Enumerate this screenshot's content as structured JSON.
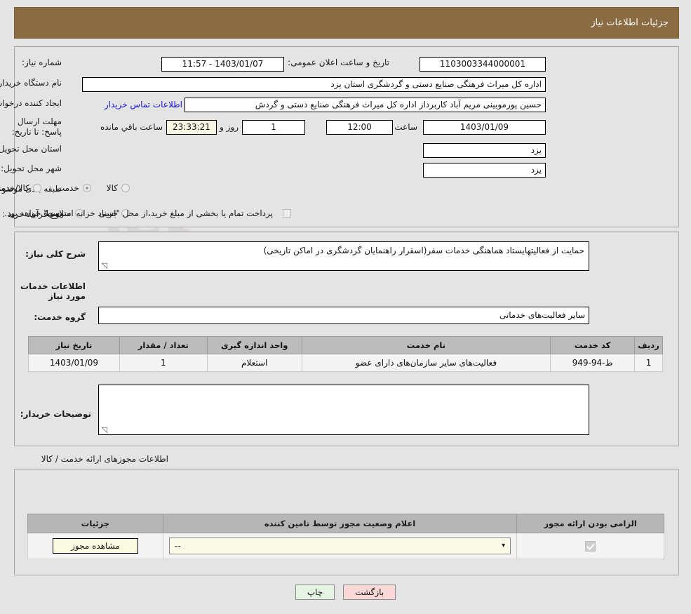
{
  "header": {
    "title": "جزئیات اطلاعات نیاز"
  },
  "fields": {
    "need_number_label": "شماره نیاز:",
    "need_number_value": "1103003344000001",
    "announce_label": "تاریخ و ساعت اعلان عمومی:",
    "announce_value": "1403/01/07 - 11:57",
    "buyer_org_label": "نام دستگاه خریدار:",
    "buyer_org_value": "اداره کل میراث فرهنگی  صنایع دستی و گردشگری استان یزد",
    "creator_label": "ایجاد کننده درخواست:",
    "creator_value": "حسین پورموبینی مریم آباد کاربرداز اداره کل میراث فرهنگی  صنایع دستی و گردش",
    "creator_link": "اطلاعات تماس خریدار",
    "deadline_label": "مهلت ارسال پاسخ: تا تاریخ:",
    "deadline_date": "1403/01/09",
    "deadline_hour_label": "ساعت",
    "deadline_hour": "12:00",
    "days_value": "1",
    "days_label": "روز و",
    "countdown": "23:33:21",
    "countdown_label": "ساعت باقي مانده",
    "province_label": "استان محل تحویل:",
    "province_value": "یزد",
    "city_label": "شهر محل تحویل:",
    "city_value": "یزد",
    "category_label": "طبقه بندی موضوعی:",
    "process_label": "نوع فرآیند خرید :",
    "treasury_note": "پرداخت تمام یا بخشی از مبلغ خرید،از محل \"اسناد خزانه اسلامی\" خواهد بود."
  },
  "category_options": [
    {
      "label": "کالا",
      "selected": false
    },
    {
      "label": "خدمت",
      "selected": true
    },
    {
      "label": "کالا/خدمت",
      "selected": false
    }
  ],
  "process_options": [
    {
      "label": "جزیی",
      "selected": false
    },
    {
      "label": "متوسط",
      "selected": false
    }
  ],
  "description": {
    "label": "شرح کلی نیاز:",
    "value": "حمایت از فعالیتهایستاد هماهنگی خدمات سفر(اسقرار راهنمایان گردشگری در اماکن  تاریخی)",
    "section_title": "اطلاعات خدمات مورد نیاز",
    "service_group_label": "گروه خدمت:",
    "service_group_value": "سایر فعالیت‌های خدماتی"
  },
  "service_table": {
    "headers": [
      "ردیف",
      "کد خدمت",
      "نام خدمت",
      "واحد اندازه گیری",
      "تعداد / مقدار",
      "تاریخ نیاز"
    ],
    "rows": [
      [
        "1",
        "ط-94-949",
        "فعالیت‌های سایر سازمان‌های دارای عضو",
        "استعلام",
        "1",
        "1403/01/09"
      ]
    ]
  },
  "buyer_notes": {
    "label": "توضیحات خریدار:",
    "value": ""
  },
  "permits": {
    "section_caption": "اطلاعات مجوزهای ارائه خدمت / کالا",
    "headers": [
      "الزامی بودن ارائه مجوز",
      "اعلام وضعیت مجوز توسط تامین کننده",
      "جزئیات"
    ],
    "rows": [
      {
        "required": true,
        "status": "--",
        "detail_button": "مشاهده مجوز"
      }
    ]
  },
  "buttons": {
    "print": "چاپ",
    "back": "بازگشت"
  },
  "watermark": {
    "text": "AriaTender.net"
  },
  "colors": {
    "header_bg": "#8a6b42",
    "link": "#1414cf",
    "page_bg": "#e4e4e4",
    "print_btn": "#e6f5e3",
    "back_btn": "#fbd8d8"
  }
}
